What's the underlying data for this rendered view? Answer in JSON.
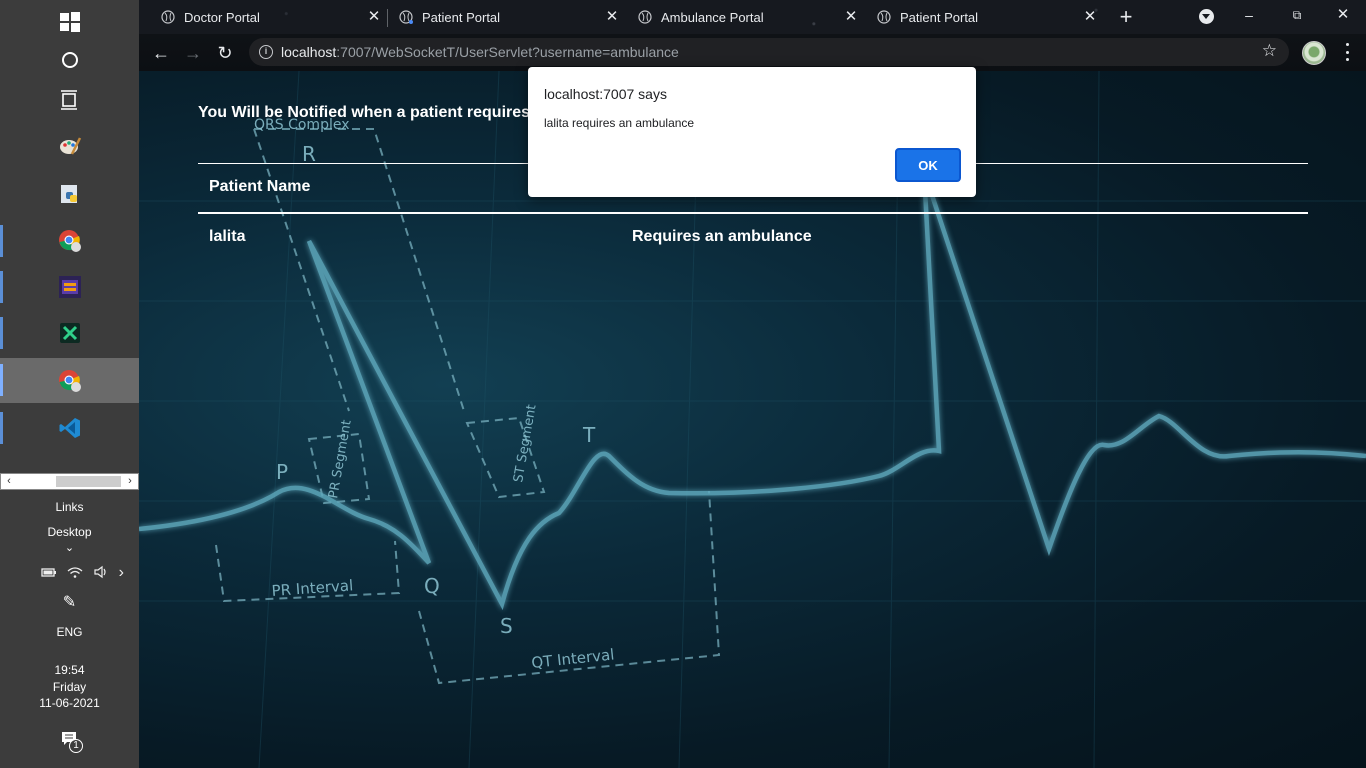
{
  "taskbar": {
    "links_label": "Links",
    "desktop_label": "Desktop",
    "language": "ENG",
    "clock": {
      "time": "19:54",
      "day": "Friday",
      "date": "11-06-2021"
    },
    "notification_count": "1"
  },
  "browser": {
    "tabs": [
      {
        "title": "Doctor Portal"
      },
      {
        "title": "Patient Portal"
      },
      {
        "title": "Ambulance Portal"
      },
      {
        "title": "Patient Portal"
      }
    ],
    "url_host": "localhost",
    "url_rest": ":7007/WebSocketT/UserServlet?username=ambulance"
  },
  "page": {
    "headline": "You Will be Notified when a patient requires",
    "table": {
      "headers": [
        "Patient Name"
      ],
      "rows": [
        {
          "name": "lalita",
          "status": "Requires an ambulance"
        }
      ]
    },
    "ecg_labels": {
      "qrs": "QRS Complex",
      "r": "R",
      "p": "P",
      "q": "Q",
      "s": "S",
      "t": "T",
      "pr_segment": "PR Segment",
      "st_segment": "ST Segment",
      "pr_interval": "PR Interval",
      "qt_interval": "QT Interval"
    }
  },
  "dialog": {
    "title": "localhost:7007 says",
    "message": "lalita requires an ambulance",
    "ok_label": "OK"
  },
  "colors": {
    "accent": "#1a73e8",
    "page_bg": "#0b2a3a",
    "ecg_line": "#6fb7c9"
  }
}
